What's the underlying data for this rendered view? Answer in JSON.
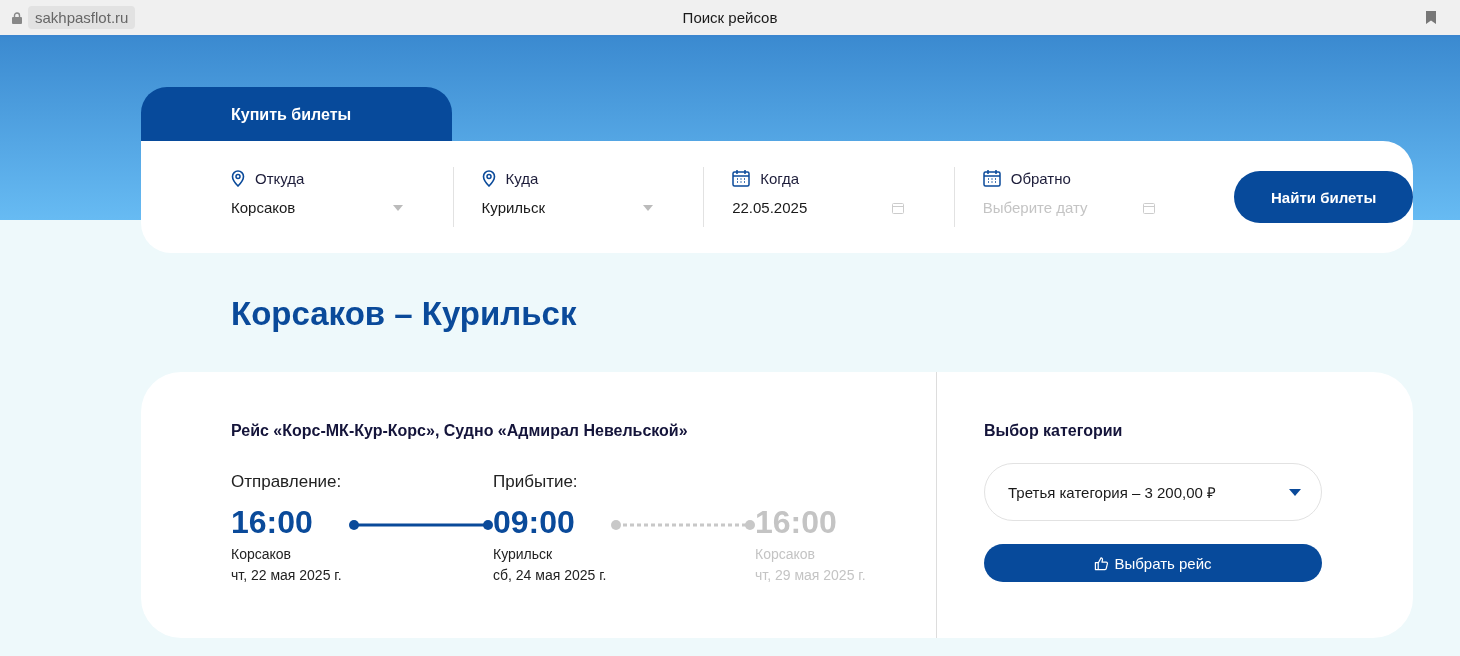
{
  "browser": {
    "url": "sakhpasflot.ru",
    "title": "Поиск рейсов"
  },
  "tabs": [
    {
      "label": "Купить билеты",
      "selected": true
    }
  ],
  "search": {
    "fields": [
      {
        "kind": "place",
        "label": "Откуда",
        "value": "Корсаков"
      },
      {
        "kind": "place",
        "label": "Куда",
        "value": "Курильск"
      },
      {
        "kind": "date",
        "label": "Когда",
        "value": "22.05.2025"
      },
      {
        "kind": "date",
        "label": "Обратно",
        "placeholder": "Выберите дату"
      }
    ],
    "button": "Найти билеты"
  },
  "route_title": "Корсаков – Курильск",
  "trip": {
    "title": "Рейс «Корс-МК-Кур-Корс», Судно «Адмирал Невельской»",
    "stops": [
      {
        "label": "Отправление:",
        "time": "16:00",
        "place": "Корсаков",
        "date": "чт, 22 мая 2025 г.",
        "active": true
      },
      {
        "label": "Прибытие:",
        "time": "09:00",
        "place": "Курильск",
        "date": "сб, 24 мая 2025 г.",
        "active": true
      },
      {
        "time": "16:00",
        "place": "Корсаков",
        "date": "чт, 29 мая 2025 г.",
        "active": false
      }
    ],
    "category_title": "Выбор категории",
    "category": "Третья категория – 3 200,00 ₽",
    "select_button": "Выбрать рейс"
  }
}
